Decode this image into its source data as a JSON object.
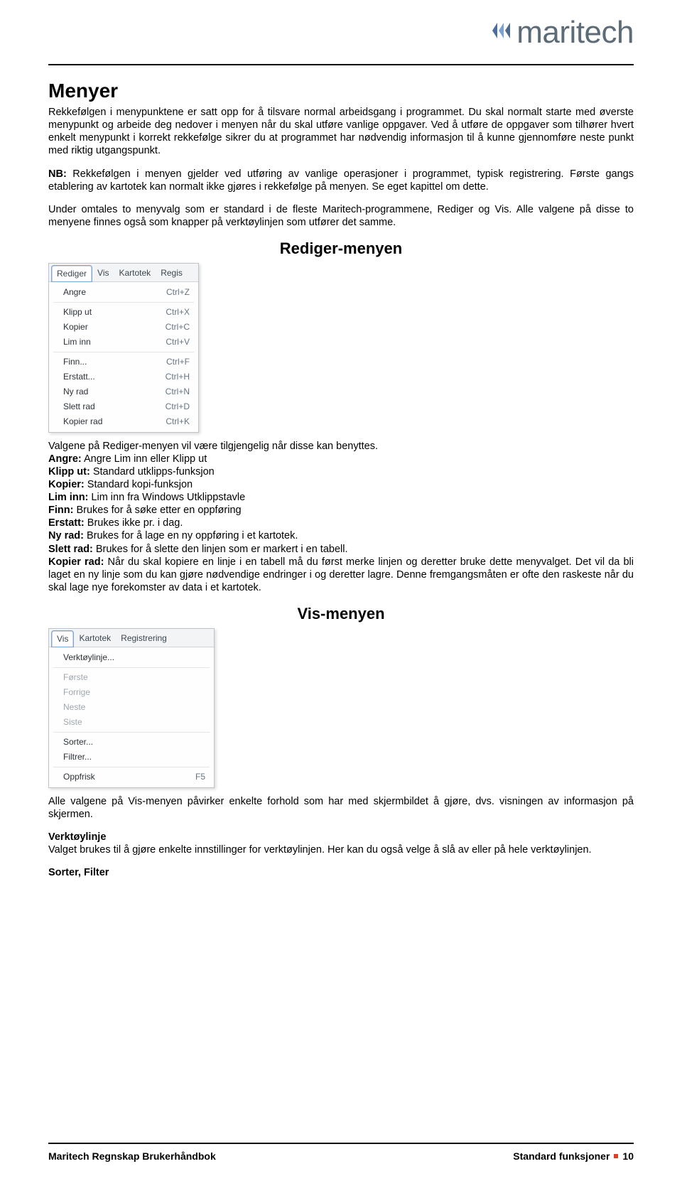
{
  "brand": "maritech",
  "h1": "Menyer",
  "p1": "Rekkefølgen i menypunktene er satt opp for å tilsvare normal arbeidsgang i programmet. Du skal normalt starte med øverste menypunkt og arbeide deg nedover i menyen når du skal utføre vanlige oppgaver. Ved å utføre de oppgaver som tilhører hvert enkelt menypunkt i korrekt rekkefølge sikrer du at programmet har nødvendig informasjon til å kunne gjennomføre neste punkt med riktig utgangspunkt.",
  "nb_pre": "NB:",
  "nb_txt": " Rekkefølgen i menyen gjelder ved utføring av vanlige operasjoner i programmet, typisk registrering. Første gangs etablering av kartotek kan normalt ikke gjøres i rekkefølge på menyen. Se eget kapittel om dette.",
  "p3": "Under omtales to menyvalg som er standard i de fleste Maritech-programmene, Rediger og Vis. Alle valgene på disse to menyene finnes også som knapper på verktøylinjen som utfører det samme.",
  "h2a": "Rediger-menyen",
  "rediger_tabs": [
    "Rediger",
    "Vis",
    "Kartotek",
    "Regis"
  ],
  "rediger_items": [
    {
      "label": "Angre",
      "sc": "Ctrl+Z"
    },
    {
      "sep": true
    },
    {
      "label": "Klipp ut",
      "sc": "Ctrl+X"
    },
    {
      "label": "Kopier",
      "sc": "Ctrl+C"
    },
    {
      "label": "Lim inn",
      "sc": "Ctrl+V"
    },
    {
      "sep": true
    },
    {
      "label": "Finn...",
      "sc": "Ctrl+F"
    },
    {
      "label": "Erstatt...",
      "sc": "Ctrl+H"
    },
    {
      "label": "Ny rad",
      "sc": "Ctrl+N"
    },
    {
      "label": "Slett rad",
      "sc": "Ctrl+D"
    },
    {
      "label": "Kopier rad",
      "sc": "Ctrl+K"
    }
  ],
  "rediger_intro": "Valgene på Rediger-menyen vil være tilgjengelig når disse kan benyttes.",
  "defs": [
    {
      "b": "Angre:",
      "t": " Angre Lim inn eller Klipp ut"
    },
    {
      "b": "Klipp ut:",
      "t": " Standard utklipps-funksjon"
    },
    {
      "b": "Kopier:",
      "t": " Standard kopi-funksjon"
    },
    {
      "b": "Lim inn:",
      "t": " Lim inn fra Windows Utklippstavle"
    },
    {
      "b": "Finn:",
      "t": " Brukes for å søke etter en oppføring"
    },
    {
      "b": "Erstatt:",
      "t": " Brukes ikke pr. i dag."
    },
    {
      "b": "Ny rad:",
      "t": " Brukes for å lage en ny oppføring i et kartotek."
    },
    {
      "b": "Slett rad:",
      "t": " Brukes for å slette den linjen som er markert i en tabell."
    }
  ],
  "kopier_rad_b": "Kopier rad:",
  "kopier_rad_t": " Når du skal kopiere en linje i en tabell må du først merke linjen og deretter bruke dette menyvalget. Det vil da bli laget en ny linje som du kan gjøre nødvendige endringer i og deretter lagre. Denne fremgangsmåten er ofte den raskeste når du skal lage nye forekomster av data i et kartotek.",
  "h2b": "Vis-menyen",
  "vis_tabs": [
    "Vis",
    "Kartotek",
    "Registrering"
  ],
  "vis_items": [
    {
      "label": "Verktøylinje..."
    },
    {
      "sep": true
    },
    {
      "label": "Første",
      "disabled": true
    },
    {
      "label": "Forrige",
      "disabled": true
    },
    {
      "label": "Neste",
      "disabled": true
    },
    {
      "label": "Siste",
      "disabled": true
    },
    {
      "sep": true
    },
    {
      "label": "Sorter..."
    },
    {
      "label": "Filtrer..."
    },
    {
      "sep": true
    },
    {
      "label": "Oppfrisk",
      "sc": "F5"
    }
  ],
  "vis_p": "Alle valgene på Vis-menyen påvirker enkelte forhold som har med skjermbildet å gjøre, dvs. visningen av informasjon på skjermen.",
  "verktoy_h": "Verktøylinje",
  "verktoy_p": "Valget brukes til å gjøre enkelte innstillinger for verktøylinjen. Her kan du også velge å slå av eller på hele verktøylinjen.",
  "sorter_h": "Sorter, Filter",
  "footer_left": "Maritech Regnskap Brukerhåndbok",
  "footer_right": "Standard funksjoner",
  "footer_page": "10"
}
